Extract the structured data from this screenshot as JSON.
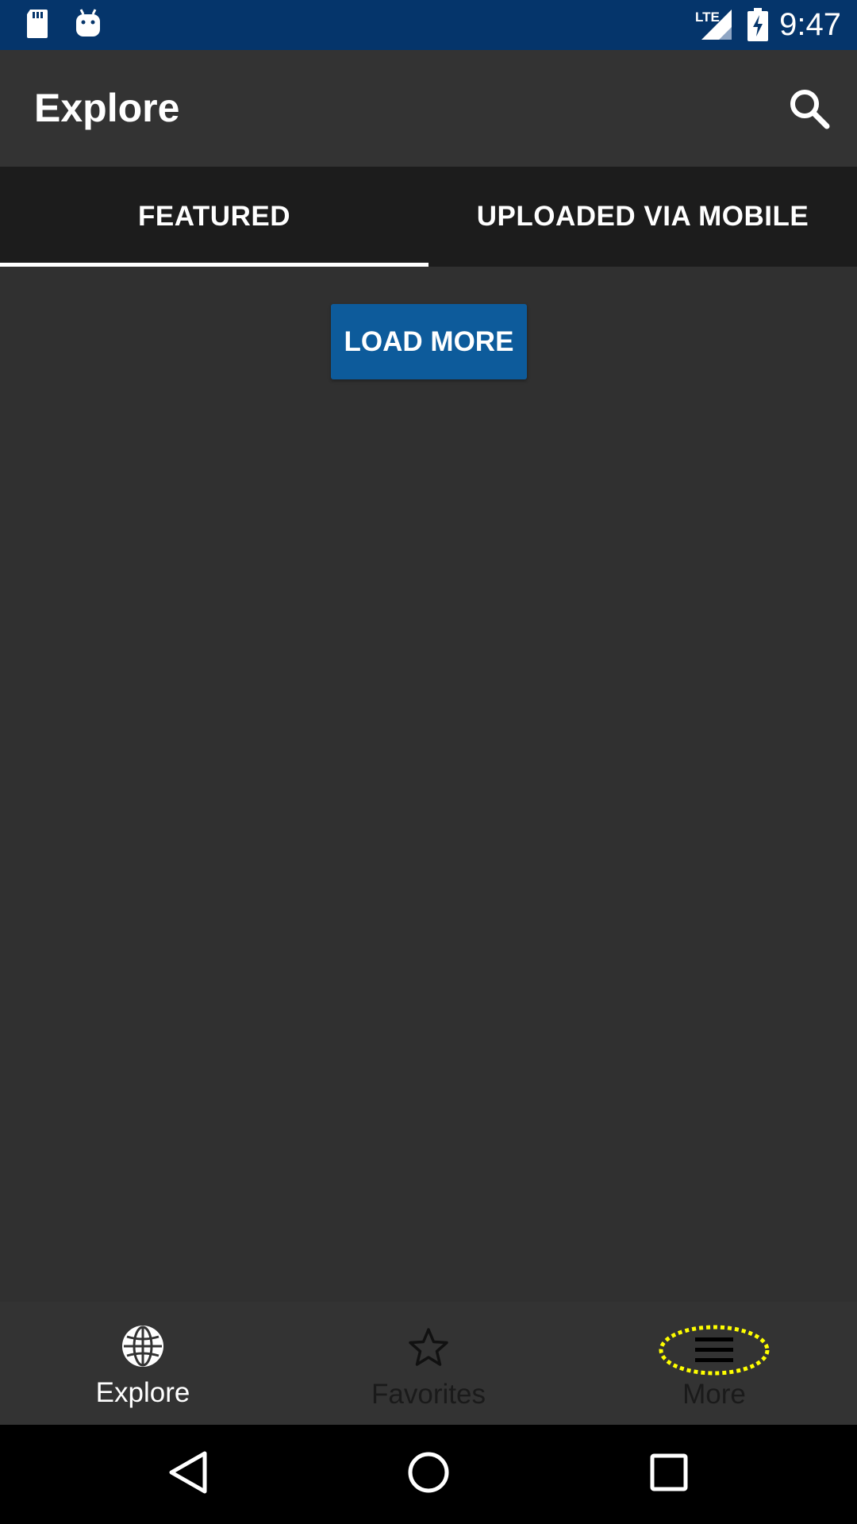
{
  "status_bar": {
    "time": "9:47",
    "network": "LTE",
    "left_icons": [
      "sd-card-icon",
      "android-debug-icon"
    ],
    "right_icons": [
      "lte-signal-icon",
      "battery-charging-icon"
    ],
    "background": "#05356b"
  },
  "app_bar": {
    "title": "Explore",
    "search_icon": "search-icon"
  },
  "tabs": [
    {
      "label": "FEATURED",
      "selected": true
    },
    {
      "label": "UPLOADED VIA MOBILE",
      "selected": false
    }
  ],
  "main": {
    "load_more_label": "LOAD MORE",
    "accent": "#0d5b9b"
  },
  "bottom_nav": [
    {
      "label": "Explore",
      "icon": "globe-icon",
      "active": true
    },
    {
      "label": "Favorites",
      "icon": "star-icon",
      "active": false
    },
    {
      "label": "More",
      "icon": "menu-icon",
      "active": false
    }
  ],
  "system_nav": [
    "back-icon",
    "home-icon",
    "recents-icon"
  ]
}
